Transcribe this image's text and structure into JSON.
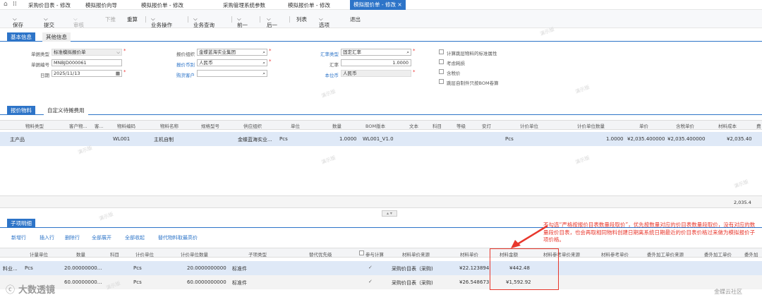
{
  "tabs": [
    "采购价目表 - 修改",
    "模拟报价向导",
    "模拟报价单 - 修改",
    "采购管理系统参数",
    "模拟报价单 - 修改",
    "模拟报价单 - 修改"
  ],
  "toolbar": {
    "save": "保存",
    "submit": "提交",
    "audit": "审核",
    "push": "下推",
    "recalc": "重算",
    "biz_op": "业务操作",
    "biz_query": "业务查询",
    "prev": "前一",
    "next": "后一",
    "list": "列表",
    "options": "选项",
    "exit": "退出"
  },
  "header_tabs": {
    "basic": "基本信息",
    "other": "其他信息"
  },
  "form": {
    "bill_type_label": "单据类型",
    "bill_type": "标准模拟报价单",
    "bill_no_label": "单据编号",
    "bill_no": "MNBJD000061",
    "date_label": "日期",
    "date": "2025/11/13",
    "org_label": "报价组织",
    "org": "金蝶蓝海实业集团",
    "currency_label": "报价币别",
    "currency": "人民币",
    "customer_label": "购货客户",
    "customer": "",
    "rate_type_label": "汇率类型",
    "rate_type": "固定汇率",
    "rate_label": "汇率",
    "rate": "1.0000",
    "local_cur_label": "本位币",
    "local_cur": "人民币",
    "chk1": "计算跳层物料的标准属性",
    "chk2": "考虑耗损",
    "chk3": "含税价",
    "chk4": "跳层自制件只按BOM卷算"
  },
  "detail_tabs": {
    "material": "报价物料",
    "custom": "自定义待摊费用"
  },
  "grid1": {
    "headers": [
      "物料类型",
      "客户物...",
      "客...",
      "物料编码",
      "物料名称",
      "规格型号",
      "供应组织",
      "单位",
      "数量",
      "BOM版本",
      "文本",
      "科目",
      "等级",
      "安灯",
      "计价单位",
      "计价单位数量",
      "单价",
      "含税单价",
      "材料成本",
      "费"
    ],
    "row": {
      "type": "主产品",
      "code": "WL001",
      "name": "主机自制",
      "org": "金蝶蓝海实业...",
      "unit": "Pcs",
      "qty": "1.0000",
      "bom": "WL001_V1.0",
      "punit": "Pcs",
      "pqty": "1.0000",
      "price": "¥2,035.400000",
      "taxprice": "¥2,035.400000",
      "cost": "¥2,035.40"
    },
    "total": "2,035.4"
  },
  "sub": {
    "tab": "子项明细",
    "actions": [
      "新增行",
      "插入行",
      "删除行",
      "全部展开",
      "全部收起",
      "替代物料取最高价"
    ],
    "headers": [
      "计量单位",
      "数量",
      "科目",
      "计价单位",
      "计价单位数量",
      "子项类型",
      "替代优先级",
      "参与计算",
      "材料单价来源",
      "材料单价",
      "材料金额",
      "材料参考单价来源",
      "材料参考单价",
      "委外加工单价来源",
      "委外加工单价",
      "委外加"
    ],
    "rows": [
      {
        "c0": "料业...",
        "unit": "Pcs",
        "qty": "20.00000000...",
        "punit": "Pcs",
        "pqty": "20.0000000000",
        "type": "标准件",
        "src": "采购价目表（采购)",
        "price": "¥22.123894",
        "amt": "¥442.48"
      },
      {
        "c0": "",
        "unit": "",
        "qty": "60.00000000...",
        "punit": "Pcs",
        "pqty": "60.0000000000",
        "type": "标准件",
        "src": "采购价目表（采购)",
        "price": "¥26.548673",
        "amt": "¥1,592.92"
      }
    ]
  },
  "annotation": "不勾选“严格按报价目表数量段取价”，优先按数量对应的价目表数量段取价，没有对应的数量段价目表，也会再取相同物料创建日期离系统日期最近的价目表价格过来做为模拟报价子项价格。",
  "brand_left": "大数透镜",
  "brand_right": "金蝶云社区",
  "watermark": "演示版",
  "colors": {
    "accent": "#2d74c8",
    "annotation": "#e8372c"
  }
}
